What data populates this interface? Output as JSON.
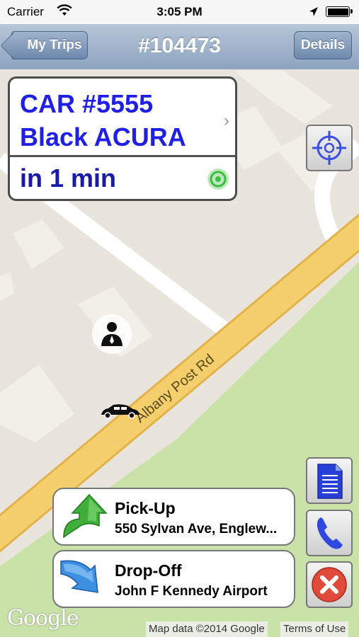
{
  "status_bar": {
    "carrier": "Carrier",
    "time": "3:05 PM"
  },
  "nav": {
    "back_label": "My Trips",
    "title": "#104473",
    "details_label": "Details"
  },
  "trip_card": {
    "car_line1": "CAR #5555",
    "car_line2": "Black ACURA",
    "eta": "in 1 min"
  },
  "map": {
    "road_label": "Albany Post Rd",
    "logo": "Google",
    "attribution": "Map data ©2014 Google",
    "terms": "Terms of Use"
  },
  "pickup": {
    "label": "Pick-Up",
    "address": "550 Sylvan Ave, Englew..."
  },
  "dropoff": {
    "label": "Drop-Off",
    "address": "John F Kennedy Airport"
  },
  "icons": {
    "wifi": "wifi-icon",
    "location": "location-arrow-icon",
    "battery": "battery-icon",
    "locate": "crosshair-icon",
    "eta": "target-icon",
    "document": "document-icon",
    "phone": "phone-icon",
    "cancel": "cancel-x-icon",
    "pickup_arrow": "green-up-arrow-icon",
    "dropoff_arrow": "blue-down-arrow-icon",
    "passenger": "passenger-marker-icon",
    "car": "car-marker-icon"
  },
  "colors": {
    "car_text": "#1f1fe6",
    "eta_text": "#1a1aa8",
    "road": "#f4cf6b",
    "park": "#c9e2a7",
    "nav": "#8da3bf",
    "cancel": "#e04a3a"
  }
}
